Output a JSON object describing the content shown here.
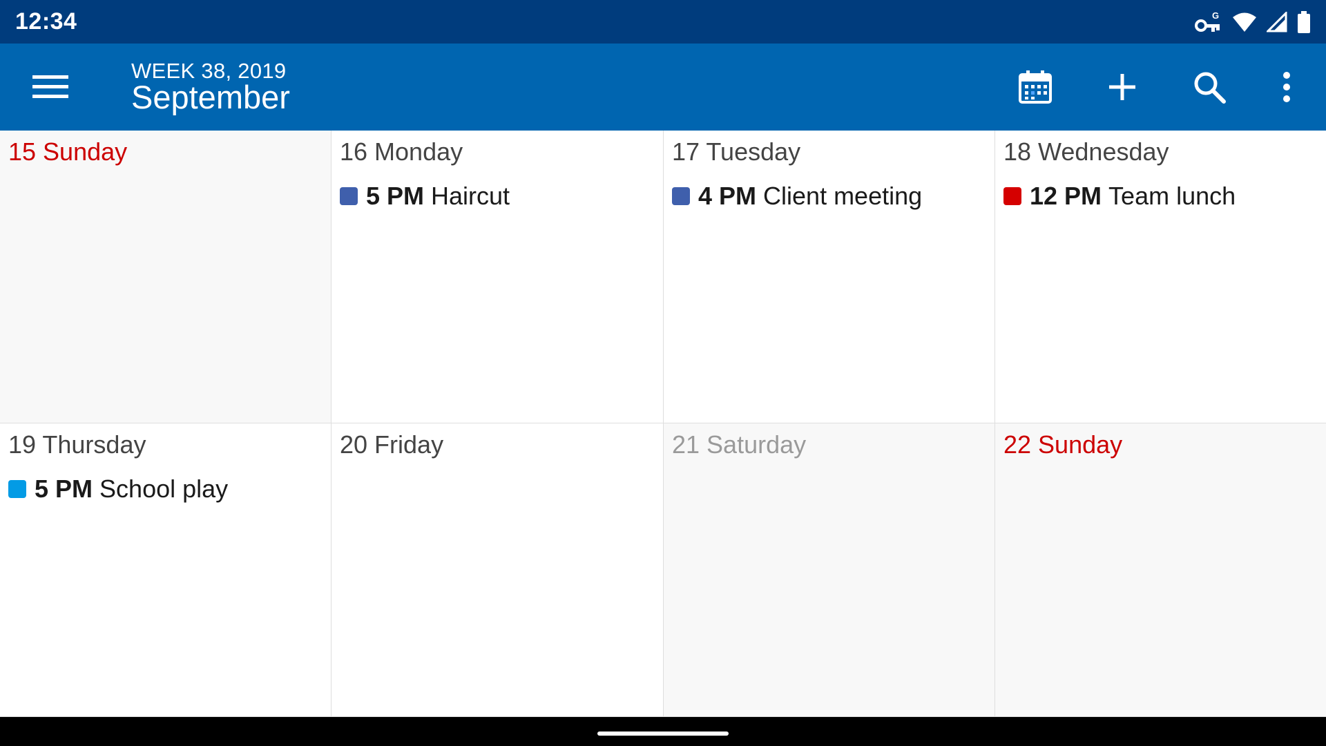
{
  "status_bar": {
    "time": "12:34",
    "icons": [
      "vpn-key-icon",
      "wifi-icon",
      "cellular-signal-icon",
      "battery-icon"
    ]
  },
  "app_bar": {
    "week_label": "WEEK 38, 2019",
    "month_label": "September",
    "actions": [
      "calendar-today-icon",
      "add-icon",
      "search-icon",
      "more-vert-icon"
    ]
  },
  "colors": {
    "status_bar": "#003c7d",
    "app_bar": "#0065b0",
    "weekend_text": "#cc0000",
    "event_blue": "#3f5fac",
    "event_red": "#d50000",
    "event_light_blue": "#039be5"
  },
  "days": [
    {
      "label": "15 Sunday",
      "style": "weekend",
      "muted": true,
      "events": []
    },
    {
      "label": "16 Monday",
      "style": "normal",
      "muted": false,
      "events": [
        {
          "time": "5 PM",
          "title": "Haircut",
          "color": "#3f5fac"
        }
      ]
    },
    {
      "label": "17 Tuesday",
      "style": "normal",
      "muted": false,
      "events": [
        {
          "time": "4 PM",
          "title": "Client meeting",
          "color": "#3f5fac"
        }
      ]
    },
    {
      "label": "18 Wednesday",
      "style": "normal",
      "muted": false,
      "events": [
        {
          "time": "12 PM",
          "title": "Team lunch",
          "color": "#d50000"
        }
      ]
    },
    {
      "label": "19 Thursday",
      "style": "normal",
      "muted": false,
      "events": [
        {
          "time": "5 PM",
          "title": "School play",
          "color": "#039be5"
        }
      ]
    },
    {
      "label": "20 Friday",
      "style": "normal",
      "muted": false,
      "events": []
    },
    {
      "label": "21 Saturday",
      "style": "dim",
      "muted": true,
      "events": []
    },
    {
      "label": "22 Sunday",
      "style": "weekend",
      "muted": true,
      "events": []
    }
  ]
}
